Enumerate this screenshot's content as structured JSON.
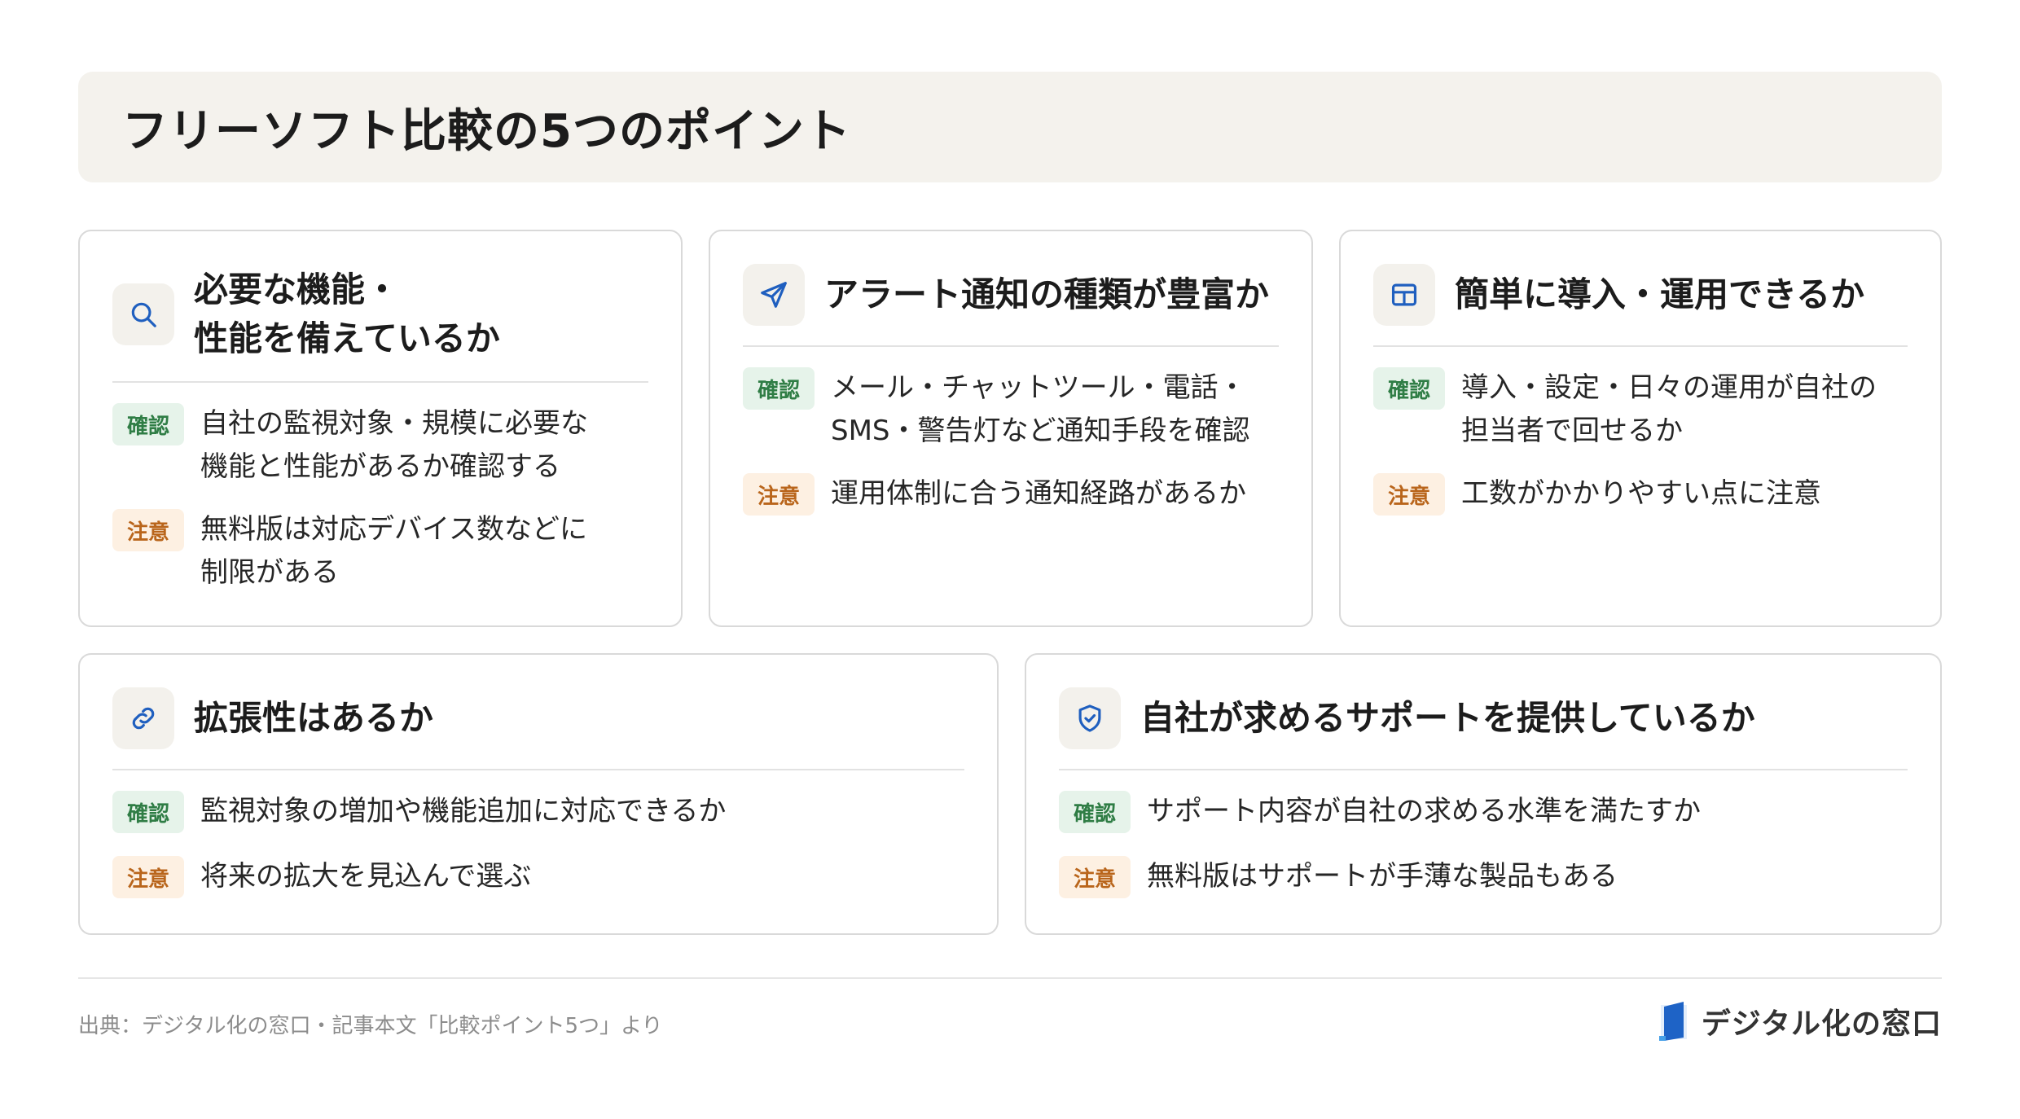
{
  "title": "フリーソフト比較の5つのポイント",
  "badges": {
    "confirm": "確認",
    "caution": "注意"
  },
  "cards": [
    {
      "icon": "search-icon",
      "title_lines": [
        "必要な機能・",
        "性能を備えているか"
      ],
      "confirm_lines": [
        "自社の監視対象・規模に必要な",
        "機能と性能があるか確認する"
      ],
      "caution_lines": [
        "無料版は対応デバイス数などに",
        "制限がある"
      ]
    },
    {
      "icon": "send-icon",
      "title_lines": [
        "アラート通知の種類が豊富か"
      ],
      "confirm_lines": [
        "メール・チャットツール・電話・",
        "SMS・警告灯など通知手段を確認"
      ],
      "caution_lines": [
        "運用体制に合う通知経路があるか"
      ]
    },
    {
      "icon": "layout-grid-icon",
      "title_lines": [
        "簡単に導入・運用できるか"
      ],
      "confirm_lines": [
        "導入・設定・日々の運用が自社の",
        "担当者で回せるか"
      ],
      "caution_lines": [
        "工数がかかりやすい点に注意"
      ]
    },
    {
      "icon": "link-icon",
      "title_lines": [
        "拡張性はあるか"
      ],
      "confirm_lines": [
        "監視対象の増加や機能追加に対応できるか"
      ],
      "caution_lines": [
        "将来の拡大を見込んで選ぶ"
      ]
    },
    {
      "icon": "shield-check-icon",
      "title_lines": [
        "自社が求めるサポートを提供しているか"
      ],
      "confirm_lines": [
        "サポート内容が自社の求める水準を満たすか"
      ],
      "caution_lines": [
        "無料版はサポートが手薄な製品もある"
      ]
    }
  ],
  "footer": {
    "source": "出典：デジタル化の窓口・記事本文「比較ポイント5つ」より",
    "brand": "デジタル化の窓口"
  },
  "colors": {
    "title_bg": "#f4f2ed",
    "icon_stroke": "#1f5fbf",
    "confirm_bg": "#e6f3ea",
    "confirm_text": "#2f7d45",
    "caution_bg": "#fdf0e2",
    "caution_text": "#b9651b",
    "brand_blue": "#1e63c6"
  }
}
